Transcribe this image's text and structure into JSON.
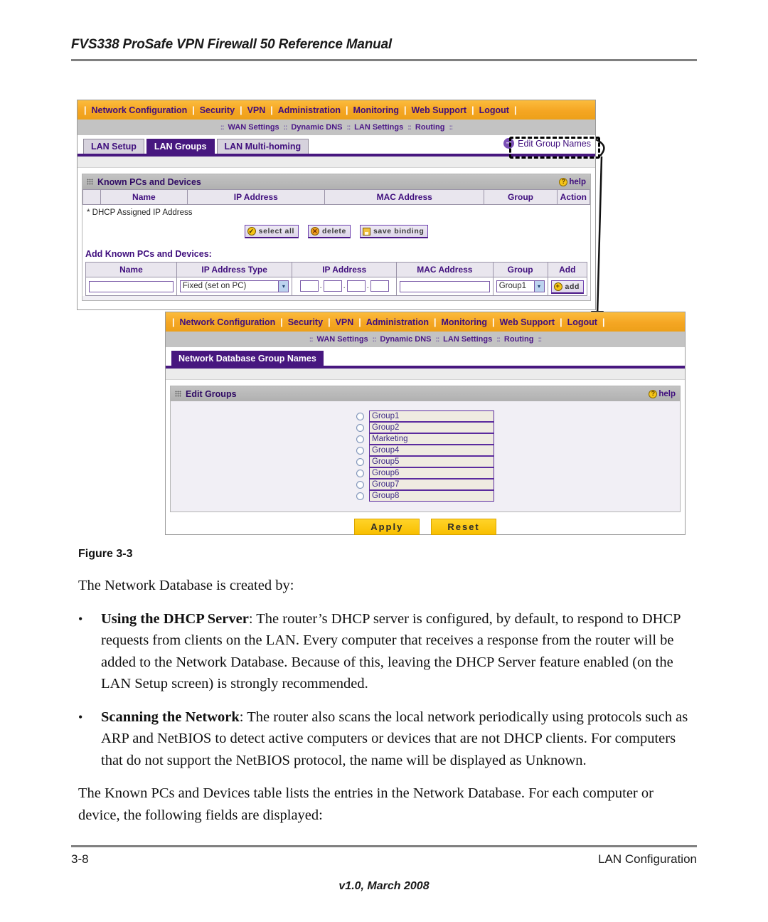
{
  "document": {
    "header_title": "FVS338 ProSafe VPN Firewall 50 Reference Manual",
    "figure_caption": "Figure 3-3",
    "intro": "The Network Database is created by:",
    "bullet_mark": "•",
    "bullets": [
      {
        "lead": "Using the DHCP Server",
        "text": ": The router’s DHCP server is configured, by default, to respond to DHCP requests from clients on the LAN. Every computer that receives a response from the router will be added to the Network Database. Because of this, leaving the DHCP Server feature enabled (on the LAN Setup screen) is strongly recommended."
      },
      {
        "lead": "Scanning the Network",
        "text": ": The router also scans the local network periodically using protocols such as ARP and NetBIOS to detect active computers or devices that are not DHCP clients. For computers that do not support the NetBIOS protocol, the name will be displayed as Unknown."
      }
    ],
    "closing": "The Known PCs and Devices table lists the entries in the Network Database. For each computer or device, the following fields are displayed:",
    "footer_page": "3-8",
    "footer_section": "LAN Configuration",
    "footer_version": "v1.0, March 2008"
  },
  "colors": {
    "navbar_orange": "#f5a623",
    "purple": "#47177f",
    "subbar_grey": "#c3c3c3",
    "section_head_grey": "#b7b7b7",
    "gold_button": "#fec700",
    "group_input_bg": "#efebe1"
  },
  "screen1": {
    "nav": {
      "separator": "|",
      "items": [
        "Network Configuration",
        "Security",
        "VPN",
        "Administration",
        "Monitoring",
        "Web Support",
        "Logout"
      ]
    },
    "subnav": {
      "dots": "::",
      "items": [
        "WAN Settings",
        "Dynamic DNS",
        "LAN Settings",
        "Routing"
      ]
    },
    "tabs": [
      {
        "label": "LAN Setup",
        "active": false
      },
      {
        "label": "LAN Groups",
        "active": true
      },
      {
        "label": "LAN Multi-homing",
        "active": false
      }
    ],
    "edit_group_names_link": "Edit Group Names",
    "known_section": {
      "title": "Known PCs and Devices",
      "help_label": "help",
      "help_glyph": "?",
      "columns": [
        "",
        "Name",
        "IP Address",
        "MAC Address",
        "Group",
        "Action"
      ],
      "rows": [],
      "note": "* DHCP Assigned IP Address",
      "buttons": [
        {
          "label": "select all",
          "icon": "check-circle-icon"
        },
        {
          "label": "delete",
          "icon": "x-circle-icon"
        },
        {
          "label": "save binding",
          "icon": "save-disk-icon"
        }
      ]
    },
    "add_section": {
      "title": "Add Known PCs and Devices:",
      "columns": [
        "Name",
        "IP Address Type",
        "IP Address",
        "MAC Address",
        "Group",
        "Add"
      ],
      "name_value": "",
      "ip_type_value": "Fixed (set on PC)",
      "ip_octets": [
        "",
        "",
        "",
        ""
      ],
      "ip_dot": ".",
      "mac_value": "",
      "group_value": "Group1",
      "add_button_label": "add",
      "caret_glyph": "▾"
    }
  },
  "screen2": {
    "nav": {
      "separator": "|",
      "items": [
        "Network Configuration",
        "Security",
        "VPN",
        "Administration",
        "Monitoring",
        "Web Support",
        "Logout"
      ]
    },
    "subnav": {
      "dots": "::",
      "items": [
        "WAN Settings",
        "Dynamic DNS",
        "LAN Settings",
        "Routing"
      ]
    },
    "page_tab": "Network Database Group Names",
    "edit_groups": {
      "title": "Edit Groups",
      "help_label": "help",
      "help_glyph": "?",
      "groups": [
        "Group1",
        "Group2",
        "Marketing",
        "Group4",
        "Group5",
        "Group6",
        "Group7",
        "Group8"
      ],
      "selected_index": -1
    },
    "apply_label": "Apply",
    "reset_label": "Reset"
  }
}
